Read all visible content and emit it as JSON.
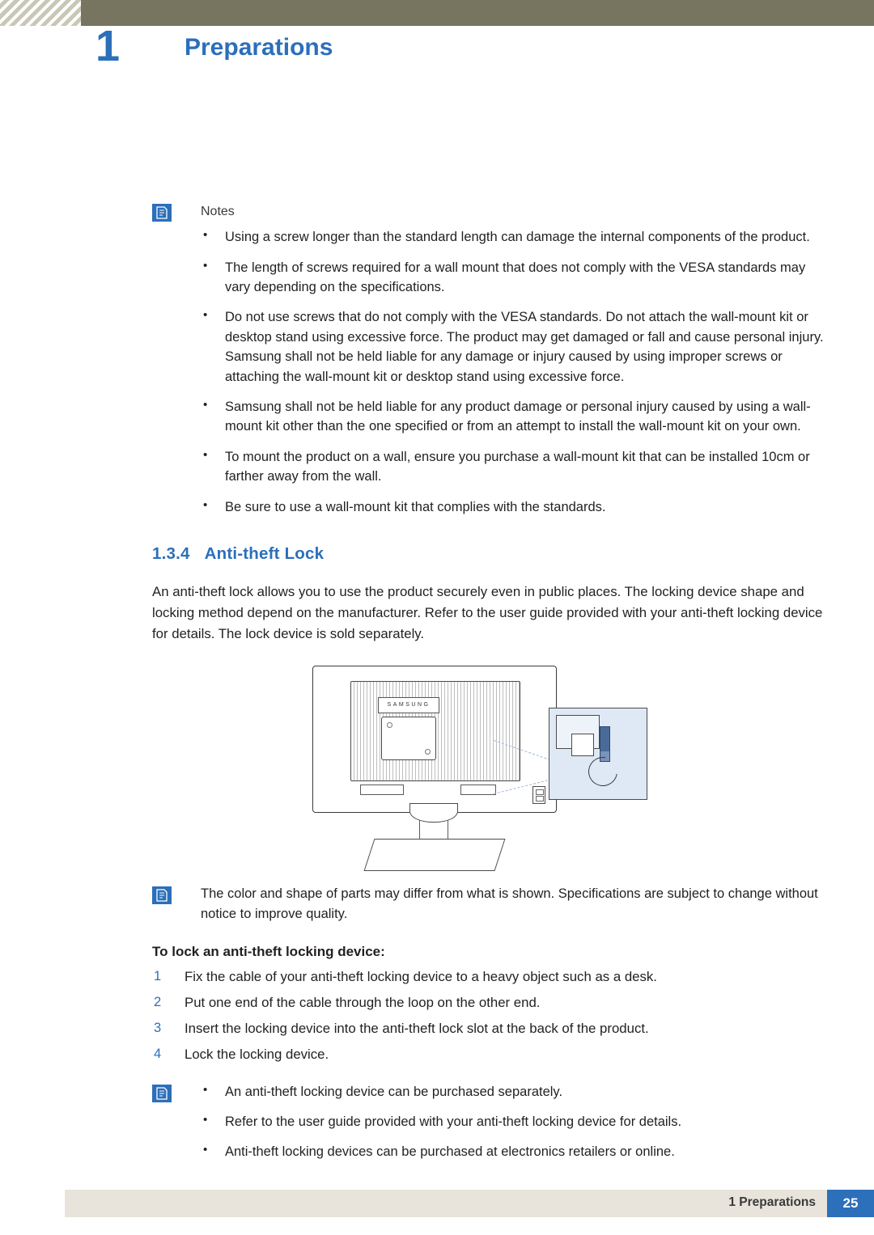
{
  "header": {
    "chapter_number": "1",
    "chapter_title": "Preparations"
  },
  "notes_block": {
    "icon": "note-icon",
    "label": "Notes",
    "items": [
      "Using a screw longer than the standard length can damage the internal components of the product.",
      "The length of screws required for a wall mount that does not comply with the VESA standards may vary depending on the specifications.",
      "Do not use screws that do not comply with the VESA standards. Do not attach the wall-mount kit or desktop stand using excessive force. The product may get damaged or fall and cause personal injury. Samsung shall not be held liable for any damage or injury caused by using improper screws or attaching the wall-mount kit or desktop stand using excessive force.",
      "Samsung shall not be held liable for any product damage or personal injury caused by using a wall-mount kit other than the one specified or from an attempt to install the wall-mount kit on your own.",
      "To mount the product on a wall, ensure you purchase a wall-mount kit that can be installed 10cm or farther away from the wall.",
      "Be sure to use a wall-mount kit that complies with the standards."
    ]
  },
  "section": {
    "number": "1.3.4",
    "title": "Anti-theft Lock",
    "intro": "An anti-theft lock allows you to use the product securely even in public places. The locking device shape and locking method depend on the manufacturer. Refer to the user guide provided with your anti-theft locking device for details. The lock device is sold separately."
  },
  "figure": {
    "brand_plate_text": "SAMSUNG",
    "alt": "Rear view of monitor with anti-theft lock slot and magnified lock detail"
  },
  "figure_note": {
    "icon": "note-icon",
    "text": "The color and shape of parts may differ from what is shown. Specifications are subject to change without notice to improve quality."
  },
  "procedure": {
    "heading": "To lock an anti-theft locking device:",
    "steps": [
      {
        "n": "1",
        "text": "Fix the cable of your anti-theft locking device to a heavy object such as a desk."
      },
      {
        "n": "2",
        "text": "Put one end of the cable through the loop on the other end."
      },
      {
        "n": "3",
        "text": "Insert the locking device into the anti-theft lock slot at the back of the product."
      },
      {
        "n": "4",
        "text": "Lock the locking device."
      }
    ]
  },
  "bottom_note": {
    "icon": "note-icon",
    "items": [
      "An anti-theft locking device can be purchased separately.",
      "Refer to the user guide provided with your anti-theft locking device for details.",
      "Anti-theft locking devices can be purchased at electronics retailers or online."
    ]
  },
  "footer": {
    "label": "1 Preparations",
    "page": "25"
  },
  "colors": {
    "accent": "#2c6fba",
    "header_bar": "#77755f",
    "footer_bg": "#e8e4dc"
  }
}
